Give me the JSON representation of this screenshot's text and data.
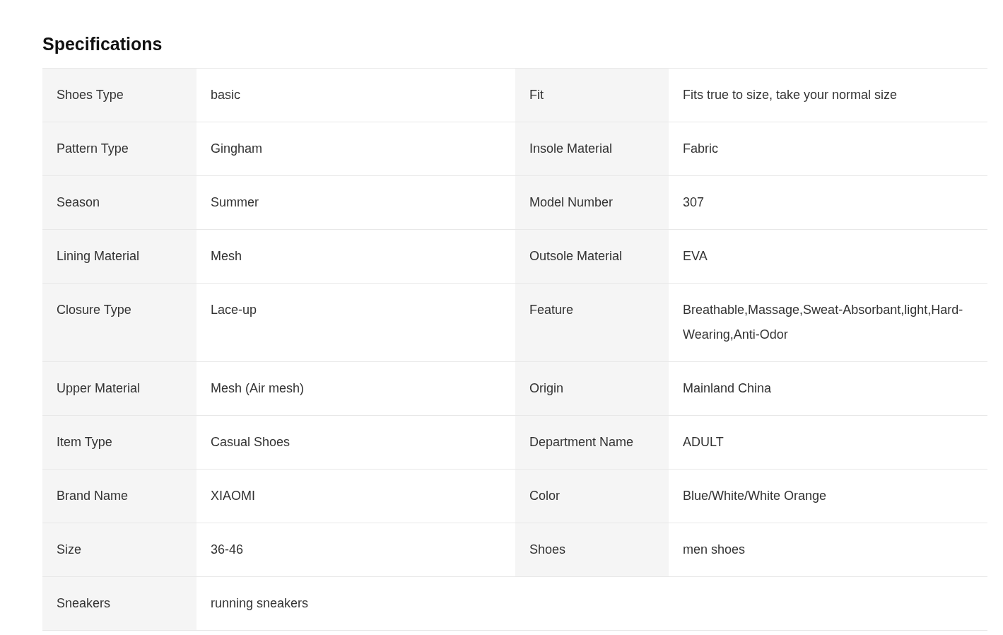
{
  "title": "Specifications",
  "rows": [
    [
      {
        "label": "Shoes Type",
        "value": "basic"
      },
      {
        "label": "Fit",
        "value": "Fits true to size, take your normal size"
      }
    ],
    [
      {
        "label": "Pattern Type",
        "value": "Gingham"
      },
      {
        "label": "Insole Material",
        "value": "Fabric"
      }
    ],
    [
      {
        "label": "Season",
        "value": "Summer"
      },
      {
        "label": "Model Number",
        "value": "307"
      }
    ],
    [
      {
        "label": "Lining Material",
        "value": "Mesh"
      },
      {
        "label": "Outsole Material",
        "value": "EVA"
      }
    ],
    [
      {
        "label": "Closure Type",
        "value": "Lace-up"
      },
      {
        "label": "Feature",
        "value": "Breathable,Massage,Sweat-Absorbant,light,Hard-Wearing,Anti-Odor"
      }
    ],
    [
      {
        "label": "Upper Material",
        "value": "Mesh (Air mesh)"
      },
      {
        "label": "Origin",
        "value": "Mainland China"
      }
    ],
    [
      {
        "label": "Item Type",
        "value": "Casual Shoes"
      },
      {
        "label": "Department Name",
        "value": "ADULT"
      }
    ],
    [
      {
        "label": "Brand Name",
        "value": "XIAOMI"
      },
      {
        "label": "Color",
        "value": "Blue/White/White Orange"
      }
    ],
    [
      {
        "label": "Size",
        "value": "36-46"
      },
      {
        "label": "Shoes",
        "value": "men shoes"
      }
    ],
    [
      {
        "label": "Sneakers",
        "value": "running sneakers"
      }
    ]
  ]
}
